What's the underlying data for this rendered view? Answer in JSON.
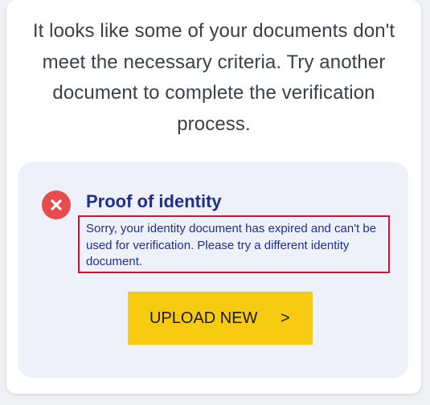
{
  "intro": {
    "text": "It looks like some of your documents don't meet the necessary criteria. Try another document to complete the verification process."
  },
  "verification_item": {
    "icon": "error-x-icon",
    "title": "Proof of identity",
    "message": "Sorry, your identity document has expired and can't be used for verification. Please try a different identity document.",
    "button_label": "UPLOAD NEW",
    "button_chevron": ">"
  },
  "colors": {
    "error": "#e84b4b",
    "title": "#1f2f8f",
    "highlight_border": "#d7132c",
    "button": "#f7cb12",
    "panel_bg": "#eef1f9"
  }
}
